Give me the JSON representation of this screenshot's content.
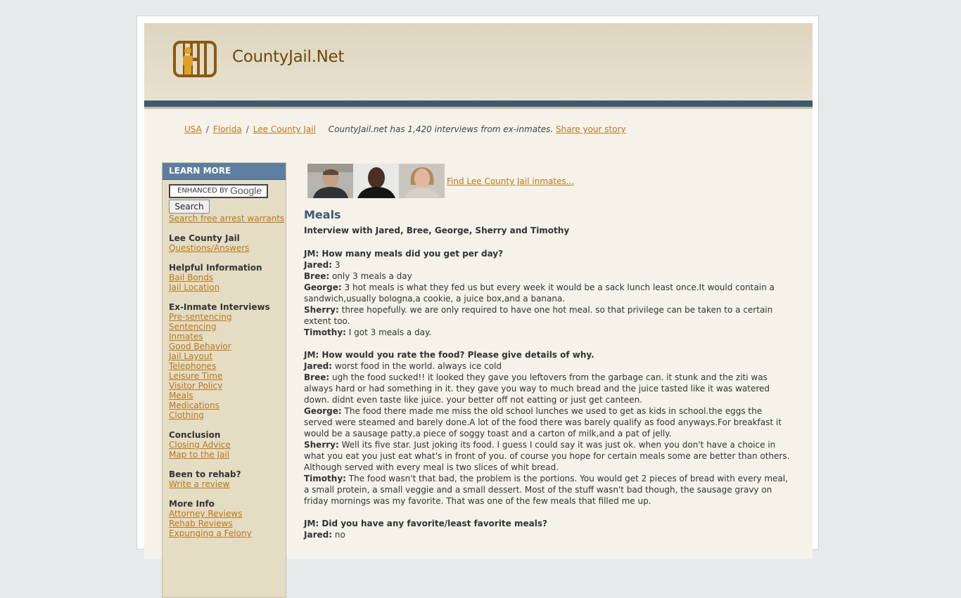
{
  "site": {
    "title": "CountyJail.Net"
  },
  "breadcrumb": {
    "items": [
      "USA",
      "Florida",
      "Lee County Jail"
    ],
    "note": "CountyJail.net has 1,420 interviews from ex-inmates.",
    "share_link": "Share your story"
  },
  "sidebar": {
    "header": "LEARN MORE",
    "search_placeholder": "ENHANCED BY",
    "search_brand": "Google",
    "search_button": "Search",
    "warrants_link": "Search free arrest warrants",
    "groups": [
      {
        "heading": "Lee County Jail",
        "links": [
          "Questions/Answers"
        ]
      },
      {
        "heading": "Helpful Information",
        "links": [
          "Bail Bonds",
          "Jail Location"
        ]
      },
      {
        "heading": "Ex-Inmate Interviews",
        "links": [
          "Pre-sentencing",
          "Sentencing",
          "Inmates",
          "Good Behavior",
          "Jail Layout",
          "Telephones",
          "Leisure Time",
          "Visitor Policy",
          "Meals",
          "Medications",
          "Clothing"
        ]
      },
      {
        "heading": "Conclusion",
        "links": [
          "Closing Advice",
          "Map to the Jail"
        ]
      },
      {
        "heading": "Been to rehab?",
        "links": [
          "Write a review"
        ]
      },
      {
        "heading": "More Info",
        "links": [
          "Attorney Reviews",
          "Rehab Reviews",
          "Expunging a Felony"
        ]
      }
    ]
  },
  "main": {
    "find_link": "Find Lee County Jail inmates...",
    "title": "Meals",
    "subtitle": "Interview with Jared, Bree, George, Sherry and Timothy",
    "questions": [
      {
        "q": "JM: How many meals did you get per day?",
        "answers": [
          {
            "name": "Jared:",
            "text": "3"
          },
          {
            "name": "Bree:",
            "text": "only 3 meals a day"
          },
          {
            "name": "George:",
            "text": "3 hot meals is what they fed us but every week it would be a sack lunch least once.It would contain a sandwich,usually bologna,a cookie, a juice box,and a banana."
          },
          {
            "name": "Sherry:",
            "text": "three hopefully. we are only required to have one hot meal. so that privilege can be taken to a certain extent too."
          },
          {
            "name": "Timothy:",
            "text": "I got 3 meals a day."
          }
        ]
      },
      {
        "q": "JM: How would you rate the food? Please give details of why.",
        "answers": [
          {
            "name": "Jared:",
            "text": "worst food in the world. always ice cold"
          },
          {
            "name": "Bree:",
            "text": "ugh the food sucked!! it looked they gave you leftovers from the garbage can. it stunk and the ziti was always hard or had something in it. they gave you way to much bread and the juice tasted like it was watered down. didnt even taste like juice. your better off not eatting or just get canteen."
          },
          {
            "name": "George:",
            "text": "The food there made me miss the old school lunches we used to get as kids in school.the eggs the served were steamed and barely done.A lot of the food there was barely qualify as food anyways.For breakfast it would be a sausage patty,a piece of soggy toast and a carton of milk,and a pat of jelly."
          },
          {
            "name": "Sherry:",
            "text": "Well its five star. Just joking its food. I guess I could say it was just ok. when you don't have a choice in what you eat you just eat what's in front of you. of course you hope for certain meals some are better than others. Although served with every meal is two slices of whit bread."
          },
          {
            "name": "Timothy:",
            "text": "The food wasn't that bad, the problem is the portions. You would get 2 pieces of bread with every meal, a small protein, a small veggie and a small dessert. Most of the stuff wasn't bad though, the sausage gravy on friday mornings was my favorite. That was one of the few meals that filled me up."
          }
        ]
      },
      {
        "q": "JM: Did you have any favorite/least favorite meals?",
        "answers": [
          {
            "name": "Jared:",
            "text": "no"
          }
        ]
      }
    ]
  }
}
